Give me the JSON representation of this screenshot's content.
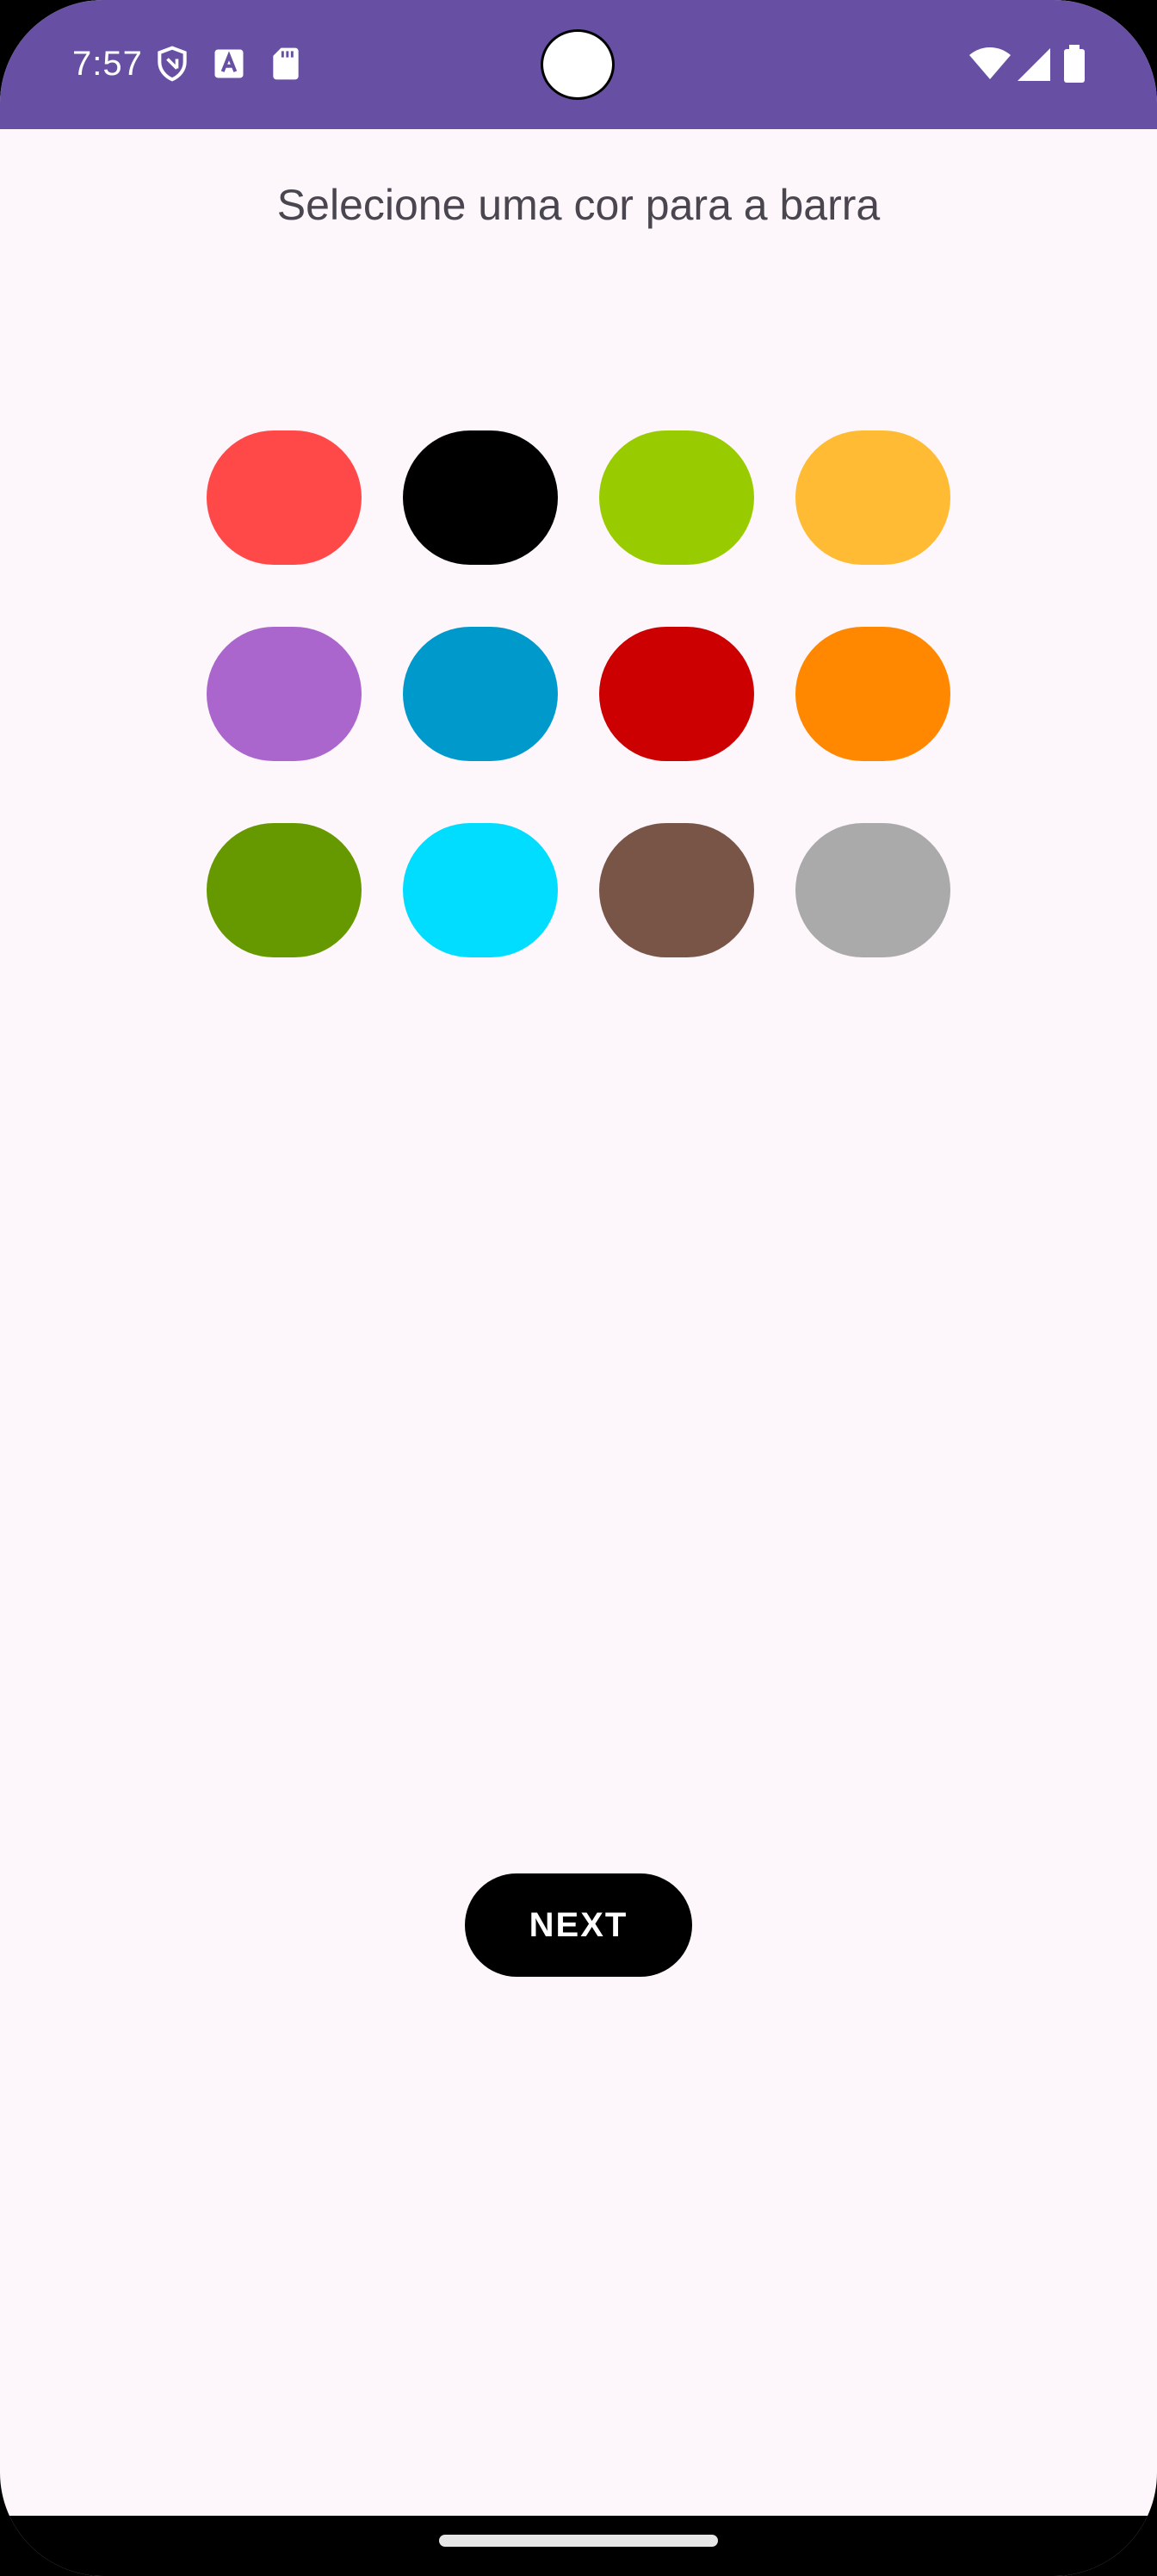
{
  "status_bar": {
    "time": "7:57",
    "background": "#6750a4",
    "left_icons": [
      "shield-icon",
      "font-icon",
      "sd-card-icon"
    ],
    "right_icons": [
      "wifi-icon",
      "cell-signal-icon",
      "battery-icon"
    ]
  },
  "screen": {
    "title": "Selecione uma cor para a barra",
    "background": "#fdf6fb"
  },
  "color_options": [
    {
      "name": "red",
      "color": "#ff4848"
    },
    {
      "name": "black",
      "color": "#000000"
    },
    {
      "name": "lime",
      "color": "#99cc00"
    },
    {
      "name": "amber",
      "color": "#ffbb33"
    },
    {
      "name": "purple",
      "color": "#aa66cc"
    },
    {
      "name": "blue",
      "color": "#0099cc"
    },
    {
      "name": "dark-red",
      "color": "#cc0000"
    },
    {
      "name": "orange",
      "color": "#ff8800"
    },
    {
      "name": "olive-green",
      "color": "#669900"
    },
    {
      "name": "cyan",
      "color": "#00ddff"
    },
    {
      "name": "brown",
      "color": "#795548"
    },
    {
      "name": "gray",
      "color": "#aaaaaa"
    }
  ],
  "actions": {
    "next_label": "NEXT"
  }
}
